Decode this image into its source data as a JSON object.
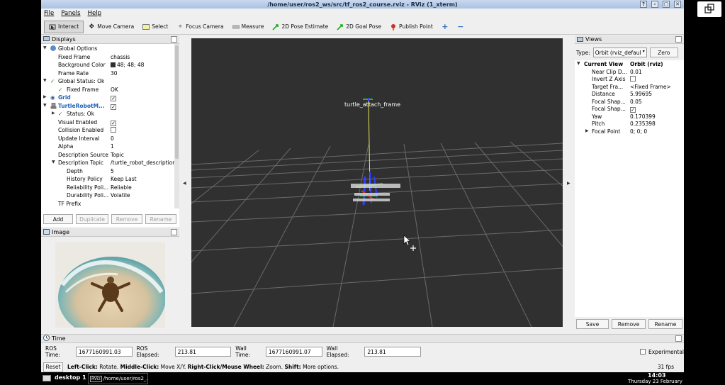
{
  "window": {
    "title": "/home/user/ros2_ws/src/tf_ros2_course.rviz - RViz (1_xterm)",
    "btn_help": "?",
    "btn_min": "-",
    "btn_max": "▢",
    "btn_close": "✕"
  },
  "menu": {
    "file": "File",
    "panels": "Panels",
    "help": "Help"
  },
  "toolbar": {
    "interact": "Interact",
    "move_camera": "Move Camera",
    "select": "Select",
    "focus_camera": "Focus Camera",
    "measure": "Measure",
    "pose_estimate": "2D Pose Estimate",
    "goal_pose": "2D Goal Pose",
    "publish_point": "Publish Point"
  },
  "displays": {
    "title": "Displays",
    "global_options": "Global Options",
    "fixed_frame_k": "Fixed Frame",
    "fixed_frame_v": "chassis",
    "bg_color_k": "Background Color",
    "bg_color_v": "48; 48; 48",
    "frame_rate_k": "Frame Rate",
    "frame_rate_v": "30",
    "global_status": "Global Status: Ok",
    "gs_fixed_frame_k": "Fixed Frame",
    "gs_fixed_frame_v": "OK",
    "grid": "Grid",
    "turtle": "TurtleRobotM...",
    "status": "Status: Ok",
    "visual_enabled": "Visual Enabled",
    "collision_enabled": "Collision Enabled",
    "update_interval_k": "Update Interval",
    "update_interval_v": "0",
    "alpha_k": "Alpha",
    "alpha_v": "1",
    "desc_source_k": "Description Source",
    "desc_source_v": "Topic",
    "desc_topic_k": "Description Topic",
    "desc_topic_v": "/turtle_robot_description",
    "depth_k": "Depth",
    "depth_v": "5",
    "history_k": "History Policy",
    "history_v": "Keep Last",
    "reliability_k": "Reliability Poli...",
    "reliability_v": "Reliable",
    "durability_k": "Durability Poli...",
    "durability_v": "Volatile",
    "tf_prefix_k": "TF Prefix",
    "btn_add": "Add",
    "btn_duplicate": "Duplicate",
    "btn_remove": "Remove",
    "btn_rename": "Rename",
    "check": "✓",
    "bg_color_hex": "#303030"
  },
  "image_panel": {
    "title": "Image"
  },
  "view3d": {
    "frame_label": "turtle_attach_frame",
    "bg": "#303030"
  },
  "views": {
    "title": "Views",
    "type_label": "Type:",
    "type_value": "Orbit (rviz_defaul",
    "zero": "Zero",
    "current_view_k": "Current View",
    "current_view_v": "Orbit (rviz)",
    "near_clip_k": "Near Clip D...",
    "near_clip_v": "0.01",
    "invert_z_k": "Invert Z Axis",
    "target_k": "Target Fra...",
    "target_v": "<Fixed Frame>",
    "distance_k": "Distance",
    "distance_v": "5.99695",
    "focal_shape_size_k": "Focal Shap...",
    "focal_shape_size_v": "0.05",
    "focal_shape_fixed_k": "Focal Shap...",
    "yaw_k": "Yaw",
    "yaw_v": "0.170399",
    "pitch_k": "Pitch",
    "pitch_v": "0.235398",
    "focal_point_k": "Focal Point",
    "focal_point_v": "0; 0; 0",
    "save": "Save",
    "remove": "Remove",
    "rename": "Rename"
  },
  "time": {
    "title": "Time",
    "ros_time_label": "ROS Time:",
    "ros_time": "1677160991.03",
    "ros_elapsed_label": "ROS Elapsed:",
    "ros_elapsed": "213.81",
    "wall_time_label": "Wall Time:",
    "wall_time": "1677160991.07",
    "wall_elapsed_label": "Wall Elapsed:",
    "wall_elapsed": "213.81",
    "experimental": "Experimental"
  },
  "status": {
    "reset": "Reset",
    "left_click_b": "Left-Click:",
    "left_click": "Rotate.",
    "middle_click_b": "Middle-Click:",
    "middle_click": "Move X/Y.",
    "right_click_b": "Right-Click/Mouse Wheel:",
    "right_click": "Zoom.",
    "shift_b": "Shift:",
    "shift": "More options.",
    "fps": "31 fps"
  },
  "taskbar": {
    "desktop": "desktop 1",
    "task": "/home/user/ros2_...",
    "task_icon": "RViz",
    "clock": "14:03",
    "date": "Thursday 23 February"
  }
}
